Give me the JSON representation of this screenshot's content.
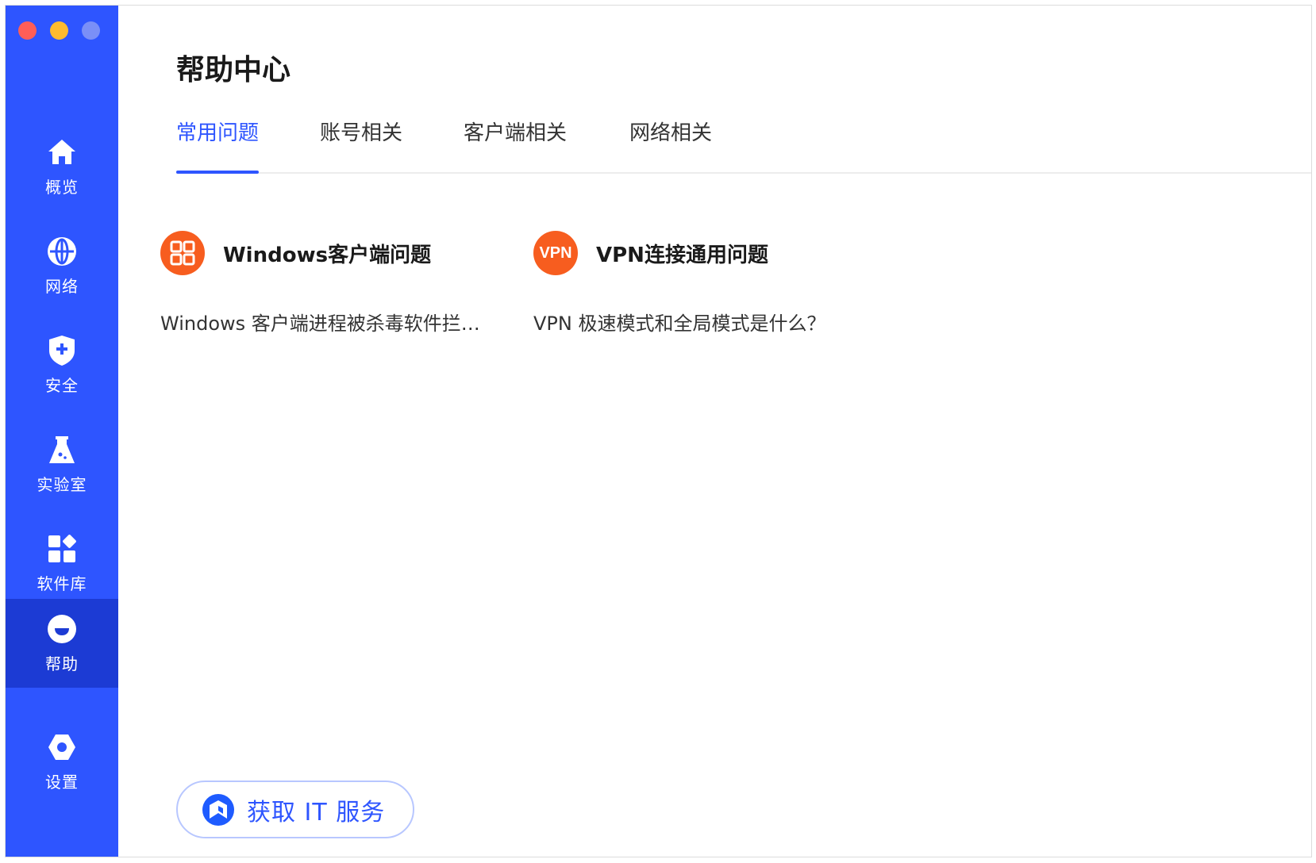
{
  "window": {
    "traffic_lights": [
      "close",
      "minimize",
      "zoom"
    ],
    "colors": {
      "sidebar": "#2e55ff",
      "sidebar_active": "#1c3bd4",
      "accent": "#2e55ff",
      "card_icon": "#f75d1f"
    }
  },
  "sidebar": {
    "items": [
      {
        "label": "概览",
        "icon": "home-icon"
      },
      {
        "label": "网络",
        "icon": "globe-icon"
      },
      {
        "label": "安全",
        "icon": "shield-icon"
      },
      {
        "label": "实验室",
        "icon": "flask-icon"
      },
      {
        "label": "软件库",
        "icon": "apps-icon"
      },
      {
        "label": "帮助",
        "icon": "help-icon",
        "active": true
      },
      {
        "label": "设置",
        "icon": "gear-icon"
      }
    ]
  },
  "main": {
    "title": "帮助中心",
    "tabs": [
      {
        "label": "常用问题",
        "active": true
      },
      {
        "label": "账号相关"
      },
      {
        "label": "客户端相关"
      },
      {
        "label": "网络相关"
      }
    ],
    "cards": [
      {
        "title": "Windows客户端问题",
        "icon": "windows-client-icon",
        "item": "Windows 客户端进程被杀毒软件拦截怎么办？"
      },
      {
        "title": "VPN连接通用问题",
        "icon": "vpn-icon",
        "icon_text": "VPN",
        "item": "VPN 极速模式和全局模式是什么？"
      }
    ],
    "it_service_button": {
      "label": "获取 IT 服务",
      "icon": "it-service-logo-icon"
    }
  }
}
